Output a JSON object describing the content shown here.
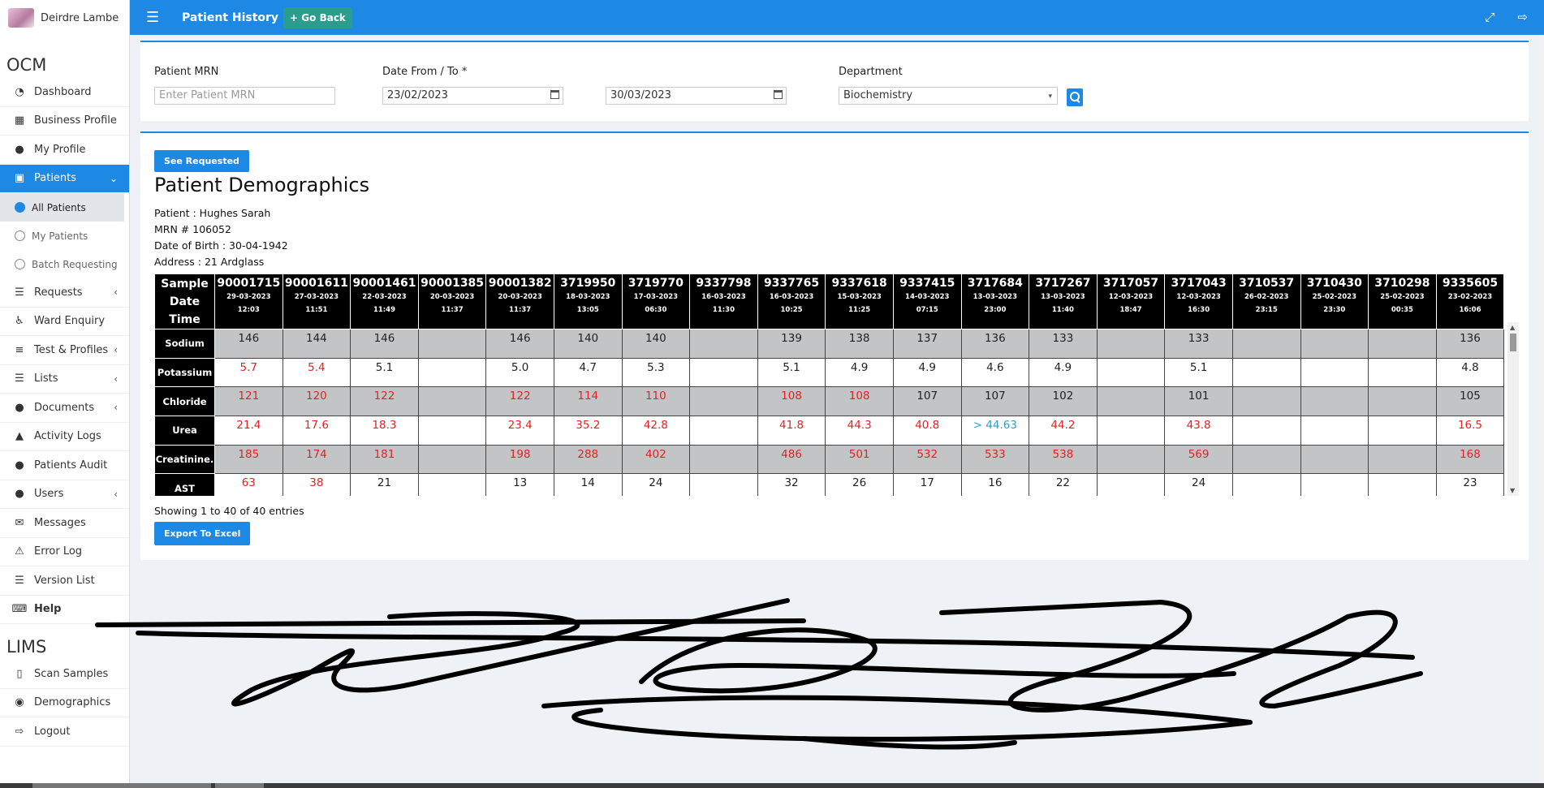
{
  "user": {
    "name": "Deirdre Lambe"
  },
  "sidebar": {
    "ocm_title": "OCM",
    "lims_title": "LIMS",
    "items": [
      {
        "label": "Dashboard",
        "icon": "dashboard-icon"
      },
      {
        "label": "Business Profile",
        "icon": "building-icon"
      },
      {
        "label": "My Profile",
        "icon": "user-icon"
      },
      {
        "label": "Patients",
        "icon": "id-card-icon",
        "active": true
      },
      {
        "label": "Requests",
        "icon": "database-icon"
      },
      {
        "label": "Ward Enquiry",
        "icon": "wheelchair-icon"
      },
      {
        "label": "Test & Profiles",
        "icon": "flask-icon"
      },
      {
        "label": "Lists",
        "icon": "list-icon"
      },
      {
        "label": "Documents",
        "icon": "users-icon"
      },
      {
        "label": "Activity Logs",
        "icon": "bank-icon"
      },
      {
        "label": "Patients Audit",
        "icon": "users-icon"
      },
      {
        "label": "Users",
        "icon": "users-icon"
      },
      {
        "label": "Messages",
        "icon": "envelope-icon"
      },
      {
        "label": "Error Log",
        "icon": "warning-icon"
      },
      {
        "label": "Version List",
        "icon": "list-icon"
      },
      {
        "label": "Help",
        "icon": "keyboard-icon"
      }
    ],
    "patients_sub": [
      {
        "label": "All Patients",
        "active": true
      },
      {
        "label": "My Patients"
      },
      {
        "label": "Batch Requesting"
      }
    ],
    "lims_items": [
      {
        "label": "Scan Samples",
        "icon": "barcode-icon"
      },
      {
        "label": "Demographics",
        "icon": "user-shield-icon"
      },
      {
        "label": "Logout",
        "icon": "sign-out-icon"
      }
    ]
  },
  "topbar": {
    "title": "Patient History",
    "go_back": "Go Back"
  },
  "filters": {
    "mrn_label": "Patient MRN",
    "mrn_placeholder": "Enter Patient MRN",
    "date_label": "Date From / To *",
    "date_from": "23/02/2023",
    "date_to": "30/03/2023",
    "dept_label": "Department",
    "dept_value": "Biochemistry"
  },
  "results": {
    "see_requested": "See Requested",
    "demographics_title": "Patient Demographics",
    "patient": "Patient : Hughes Sarah",
    "mrn": "MRN # 106052",
    "dob": "Date of Birth : 30-04-1942",
    "address": "Address : 21 Ardglass",
    "entries_info": "Showing 1 to 40 of 40 entries",
    "export": "Export To Excel"
  },
  "grid": {
    "corner": [
      "Sample",
      "Date",
      "Time"
    ],
    "samples": [
      {
        "id": "90001715",
        "date": "29-03-2023",
        "time": "12:03"
      },
      {
        "id": "90001611",
        "date": "27-03-2023",
        "time": "11:51"
      },
      {
        "id": "90001461",
        "date": "22-03-2023",
        "time": "11:49"
      },
      {
        "id": "90001385",
        "date": "20-03-2023",
        "time": "11:37"
      },
      {
        "id": "90001382",
        "date": "20-03-2023",
        "time": "11:37"
      },
      {
        "id": "3719950",
        "date": "18-03-2023",
        "time": "13:05"
      },
      {
        "id": "3719770",
        "date": "17-03-2023",
        "time": "06:30"
      },
      {
        "id": "9337798",
        "date": "16-03-2023",
        "time": "11:30"
      },
      {
        "id": "9337765",
        "date": "16-03-2023",
        "time": "10:25"
      },
      {
        "id": "9337618",
        "date": "15-03-2023",
        "time": "11:25"
      },
      {
        "id": "9337415",
        "date": "14-03-2023",
        "time": "07:15"
      },
      {
        "id": "3717684",
        "date": "13-03-2023",
        "time": "23:00"
      },
      {
        "id": "3717267",
        "date": "13-03-2023",
        "time": "11:40"
      },
      {
        "id": "3717057",
        "date": "12-03-2023",
        "time": "18:47"
      },
      {
        "id": "3717043",
        "date": "12-03-2023",
        "time": "16:30"
      },
      {
        "id": "3710537",
        "date": "26-02-2023",
        "time": "23:15"
      },
      {
        "id": "3710430",
        "date": "25-02-2023",
        "time": "23:30"
      },
      {
        "id": "3710298",
        "date": "25-02-2023",
        "time": "00:35"
      },
      {
        "id": "9335605",
        "date": "23-02-2023",
        "time": "16:06"
      }
    ],
    "rows": [
      {
        "name": "Sodium",
        "values": [
          "146",
          "144",
          "146",
          "",
          "146",
          "140",
          "140",
          "",
          "139",
          "138",
          "137",
          "136",
          "133",
          "",
          "133",
          "",
          "",
          "",
          "136"
        ],
        "flags": [
          "",
          "",
          "",
          "",
          "",
          "",
          "",
          "",
          "",
          "",
          "",
          "",
          "",
          "",
          "",
          "",
          "",
          "",
          ""
        ]
      },
      {
        "name": "Potassium",
        "values": [
          "5.7",
          "5.4",
          "5.1",
          "",
          "5.0",
          "4.7",
          "5.3",
          "",
          "5.1",
          "4.9",
          "4.9",
          "4.6",
          "4.9",
          "",
          "5.1",
          "",
          "",
          "",
          "4.8"
        ],
        "flags": [
          "r",
          "r",
          "",
          "",
          "",
          "",
          "",
          "",
          "",
          "",
          "",
          "",
          "",
          "",
          "",
          "",
          "",
          "",
          ""
        ]
      },
      {
        "name": "Chloride",
        "values": [
          "121",
          "120",
          "122",
          "",
          "122",
          "114",
          "110",
          "",
          "108",
          "108",
          "107",
          "107",
          "102",
          "",
          "101",
          "",
          "",
          "",
          "105"
        ],
        "flags": [
          "r",
          "r",
          "r",
          "",
          "r",
          "r",
          "r",
          "",
          "r",
          "r",
          "",
          "",
          "",
          "",
          "",
          "",
          "",
          "",
          ""
        ]
      },
      {
        "name": "Urea",
        "values": [
          "21.4",
          "17.6",
          "18.3",
          "",
          "23.4",
          "35.2",
          "42.8",
          "",
          "41.8",
          "44.3",
          "40.8",
          "> 44.63",
          "44.2",
          "",
          "43.8",
          "",
          "",
          "",
          "16.5"
        ],
        "flags": [
          "r",
          "r",
          "r",
          "",
          "r",
          "r",
          "r",
          "",
          "r",
          "r",
          "r",
          "b",
          "r",
          "",
          "r",
          "",
          "",
          "",
          "r"
        ]
      },
      {
        "name": "Creatinine.",
        "values": [
          "185",
          "174",
          "181",
          "",
          "198",
          "288",
          "402",
          "",
          "486",
          "501",
          "532",
          "533",
          "538",
          "",
          "569",
          "",
          "",
          "",
          "168"
        ],
        "flags": [
          "r",
          "r",
          "r",
          "",
          "r",
          "r",
          "r",
          "",
          "r",
          "r",
          "r",
          "r",
          "r",
          "",
          "r",
          "",
          "",
          "",
          "r"
        ]
      },
      {
        "name": "AST",
        "values": [
          "63",
          "38",
          "21",
          "",
          "13",
          "14",
          "24",
          "",
          "32",
          "26",
          "17",
          "16",
          "22",
          "",
          "24",
          "",
          "",
          "",
          "23"
        ],
        "flags": [
          "r",
          "r",
          "",
          "",
          "",
          "",
          "",
          "",
          "",
          "",
          "",
          "",
          "",
          "",
          "",
          "",
          "",
          "",
          ""
        ]
      }
    ]
  }
}
